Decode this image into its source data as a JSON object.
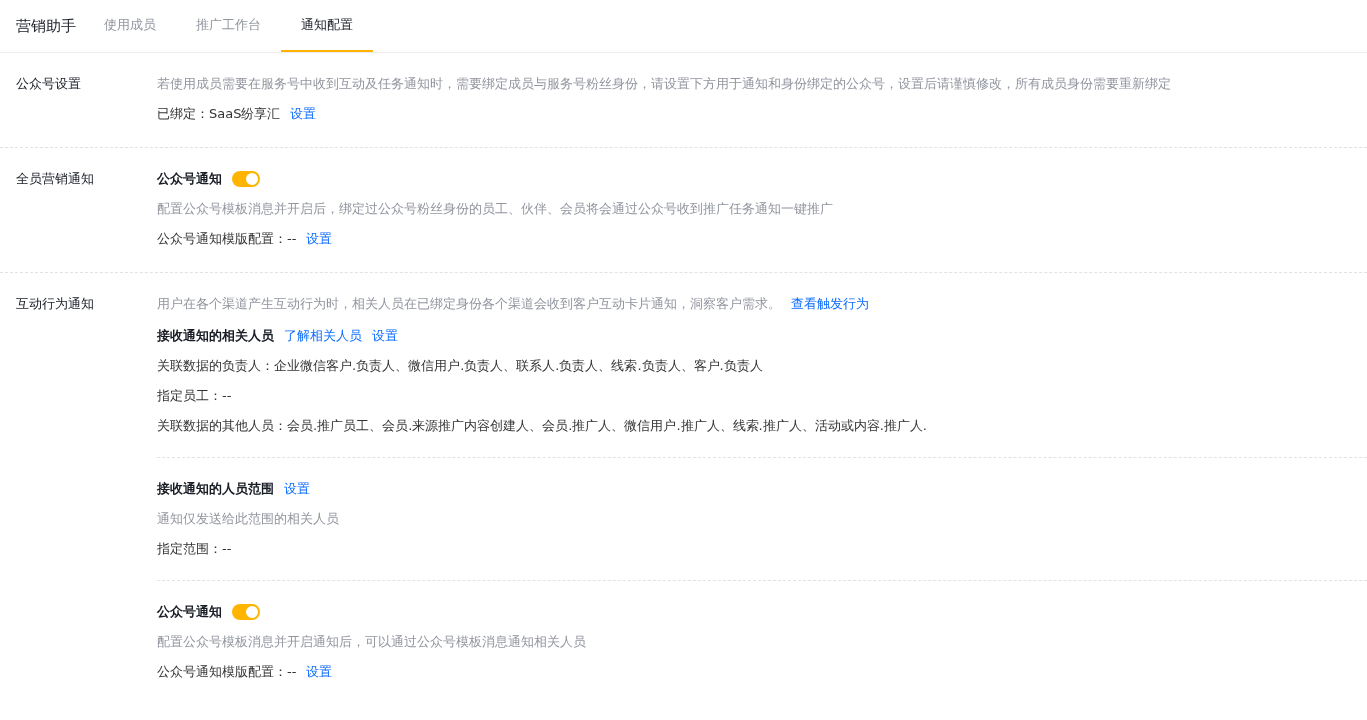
{
  "header": {
    "title": "营销助手",
    "tabs": [
      {
        "label": "使用成员",
        "selected": false
      },
      {
        "label": "推广工作台",
        "selected": false
      },
      {
        "label": "通知配置",
        "selected": true
      }
    ]
  },
  "sections": [
    {
      "label": "公众号设置",
      "blocks": [
        {
          "separated": false,
          "lines": [
            {
              "kind": "desc",
              "text": "若使用成员需要在服务号中收到互动及任务通知时，需要绑定成员与服务号粉丝身份，请设置下方用于通知和身份绑定的公众号，设置后请谨慎修改，所有成员身份需要重新绑定"
            },
            {
              "kind": "field",
              "text": "已绑定：SaaS纷享汇",
              "links": [
                "设置"
              ]
            }
          ]
        }
      ]
    },
    {
      "label": "全员营销通知",
      "blocks": [
        {
          "separated": false,
          "title": "公众号通知",
          "toggle": {
            "on": true
          },
          "lines": [
            {
              "kind": "desc",
              "text": "配置公众号模板消息并开启后，绑定过公众号粉丝身份的员工、伙伴、会员将会通过公众号收到推广任务通知一键推广"
            },
            {
              "kind": "field",
              "text": "公众号通知模版配置：--",
              "links": [
                "设置"
              ]
            }
          ]
        }
      ]
    },
    {
      "label": "互动行为通知",
      "blocks": [
        {
          "separated": false,
          "lines": [
            {
              "kind": "desc",
              "text": "用户在各个渠道产生互动行为时，相关人员在已绑定身份各个渠道会收到客户互动卡片通知，洞察客户需求。",
              "links": [
                "查看触发行为"
              ]
            }
          ]
        },
        {
          "separated": false,
          "title": "接收通知的相关人员",
          "links": [
            "了解相关人员",
            "设置"
          ],
          "lines": [
            {
              "kind": "field",
              "text": "关联数据的负责人：企业微信客户.负责人、微信用户.负责人、联系人.负责人、线索.负责人、客户.负责人"
            },
            {
              "kind": "field",
              "text": "指定员工：--"
            },
            {
              "kind": "field",
              "text": "关联数据的其他人员：会员.推广员工、会员.来源推广内容创建人、会员.推广人、微信用户.推广人、线索.推广人、活动或内容.推广人."
            }
          ]
        },
        {
          "separated": true,
          "title": "接收通知的人员范围",
          "links": [
            "设置"
          ],
          "lines": [
            {
              "kind": "desc",
              "text": "通知仅发送给此范围的相关人员"
            },
            {
              "kind": "field",
              "text": "指定范围：--"
            }
          ]
        },
        {
          "separated": true,
          "title": "公众号通知",
          "toggle": {
            "on": true
          },
          "lines": [
            {
              "kind": "desc",
              "text": "配置公众号模板消息并开启通知后，可以通过公众号模板消息通知相关人员"
            },
            {
              "kind": "field",
              "text": "公众号通知模版配置：--",
              "links": [
                "设置"
              ]
            }
          ]
        }
      ]
    }
  ]
}
